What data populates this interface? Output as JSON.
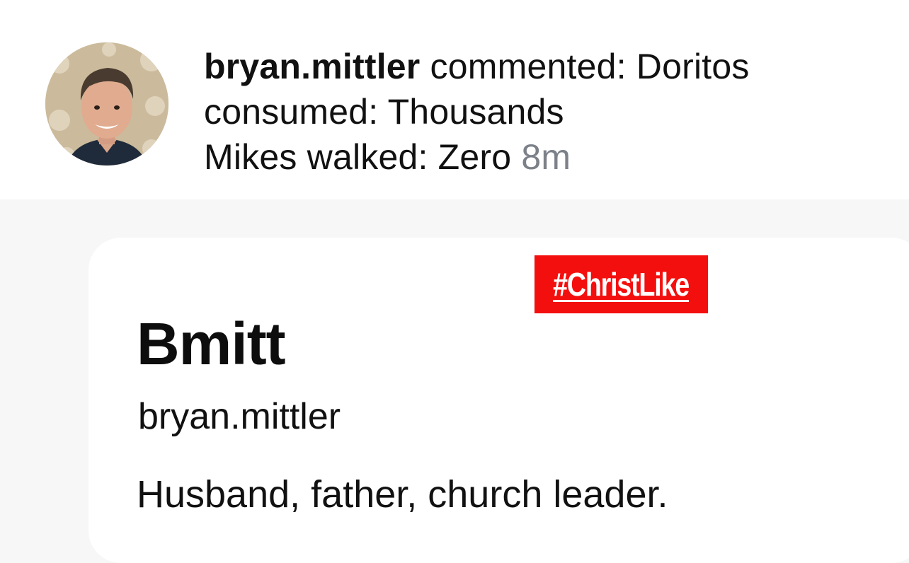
{
  "notification": {
    "avatar_icon": "profile-photo",
    "username": "bryan.mittler",
    "line1_rest": " commented: Doritos",
    "line2": "consumed: Thousands",
    "line3": "Mikes walked: Zero ",
    "timestamp": "8m"
  },
  "hashtag_badge": {
    "text": "#ChristLike",
    "background_color": "#f40f0f",
    "text_color": "#ffffff"
  },
  "profile": {
    "display_name": "Bmitt",
    "handle": "bryan.mittler",
    "bio": "Husband, father, church leader."
  },
  "colors": {
    "timestamp": "#7c8189",
    "page_background": "#f7f7f7",
    "card_background": "#ffffff"
  }
}
